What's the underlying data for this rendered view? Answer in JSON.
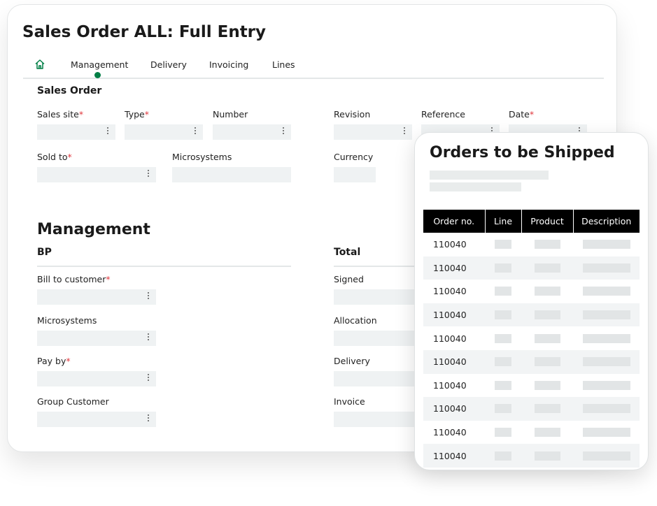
{
  "page": {
    "title": "Sales Order ALL: Full Entry",
    "tabs": [
      "Management",
      "Delivery",
      "Invoicing",
      "Lines"
    ]
  },
  "sales_order": {
    "heading": "Sales Order",
    "fields": {
      "sales_site": "Sales site",
      "type": "Type",
      "number": "Number",
      "revision": "Revision",
      "reference": "Reference",
      "date": "Date",
      "sold_to": "Sold to",
      "microsystems": "Microsystems",
      "currency": "Currency"
    }
  },
  "management": {
    "heading": "Management",
    "bp": {
      "heading": "BP",
      "bill_to_customer": "Bill to customer",
      "microsystems": "Microsystems",
      "pay_by": "Pay by",
      "group_customer": "Group Customer"
    },
    "total": {
      "heading": "Total",
      "signed": "Signed",
      "allocation": "Allocation",
      "delivery": "Delivery",
      "invoice": "Invoice"
    }
  },
  "orders_panel": {
    "title": "Orders to be Shipped",
    "columns": [
      "Order no.",
      "Line",
      "Product",
      "Description"
    ],
    "rows": [
      "110040",
      "110040",
      "110040",
      "110040",
      "110040",
      "110040",
      "110040",
      "110040",
      "110040",
      "110040"
    ]
  },
  "required_marker": "*",
  "colors": {
    "accent": "#007e45",
    "required": "#e0383e",
    "field_bg": "#eff2f3",
    "header_bg": "#000000"
  }
}
